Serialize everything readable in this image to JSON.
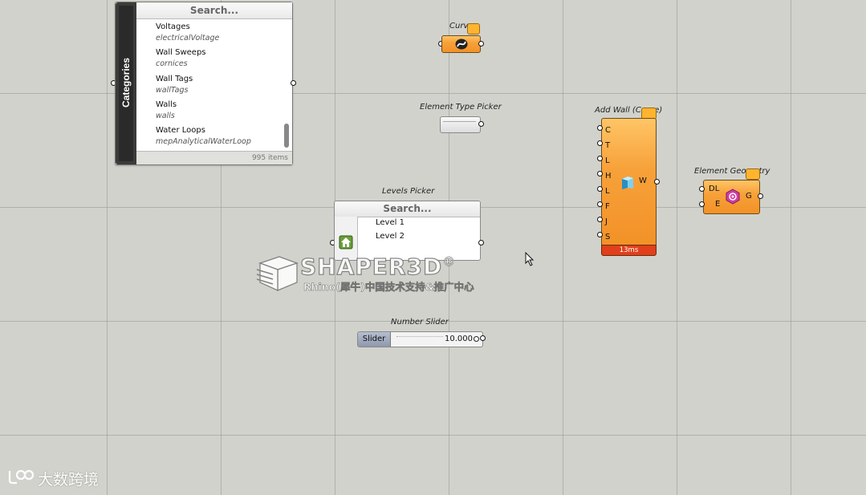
{
  "categories": {
    "side_label": "Categories",
    "search_placeholder": "Search...",
    "items": [
      {
        "name": "Voltages",
        "sub": "electricalVoltage"
      },
      {
        "name": "Wall Sweeps",
        "sub": "cornices"
      },
      {
        "name": "Wall Tags",
        "sub": "wallTags"
      },
      {
        "name": "Walls",
        "sub": "walls"
      },
      {
        "name": "Water Loops",
        "sub": "mepAnalyticalWaterLoop"
      }
    ],
    "count": "995 items"
  },
  "curve": {
    "caption": "Curv"
  },
  "element_type_picker": {
    "caption": "Element Type Picker"
  },
  "add_wall": {
    "caption": "Add Wall (Curve)",
    "inputs": [
      "C",
      "T",
      "L",
      "H",
      "L",
      "F",
      "J",
      "S"
    ],
    "output": "W",
    "timing": "13ms"
  },
  "element_geometry": {
    "caption": "Element Geometry",
    "inputs": [
      "DL",
      "E"
    ],
    "output": "G"
  },
  "levels_picker": {
    "caption": "Levels Picker",
    "search_placeholder": "Search...",
    "items": [
      "Level 1",
      "Level 2"
    ]
  },
  "watermark": {
    "title": "SHAPER3D",
    "mark": "®",
    "subtitle": "Rhino(犀牛)中国技术支持&推广中心"
  },
  "number_slider": {
    "caption": "Number Slider",
    "label": "Slider",
    "value": "10.000"
  },
  "bottom_watermark": {
    "text": "大数跨境"
  },
  "colors": {
    "canvas": "#d2d2cd",
    "component_orange": "#f7a13a",
    "timing_red": "#e0401c",
    "categories_side": "#3b3b3b"
  }
}
